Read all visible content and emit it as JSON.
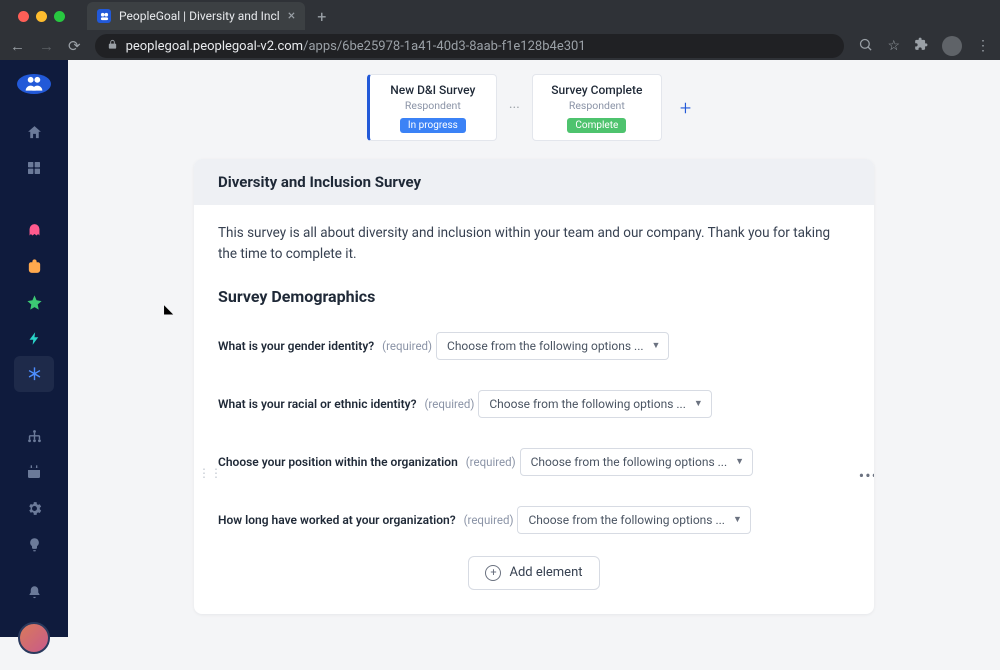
{
  "browser": {
    "tab_title": "PeopleGoal | Diversity and Incl",
    "url_domain": "peoplegoal.peoplegoal-v2.com",
    "url_path": "/apps/6be25978-1a41-40d3-8aab-f1e128b4e301"
  },
  "workflow": {
    "steps": [
      {
        "title": "New D&I Survey",
        "subtitle": "Respondent",
        "badge": "In progress",
        "badge_type": "progress",
        "current": true
      },
      {
        "title": "Survey Complete",
        "subtitle": "Respondent",
        "badge": "Complete",
        "badge_type": "complete",
        "current": false
      }
    ],
    "separator": "···",
    "add_label": "+"
  },
  "survey": {
    "header": "Diversity and Inclusion Survey",
    "intro": "This survey is all about diversity and inclusion within your team and our company. Thank you for taking the time to complete it.",
    "section_title": "Survey Demographics",
    "required_tag": "(required)",
    "select_placeholder": "Choose from the following options ...",
    "questions": [
      {
        "label": "What is your gender identity?"
      },
      {
        "label": "What is your racial or ethnic identity?"
      },
      {
        "label": "Choose your position within the organization",
        "show_handles": true
      },
      {
        "label": "How long have worked at your organization?"
      }
    ],
    "add_element_label": "Add element"
  }
}
